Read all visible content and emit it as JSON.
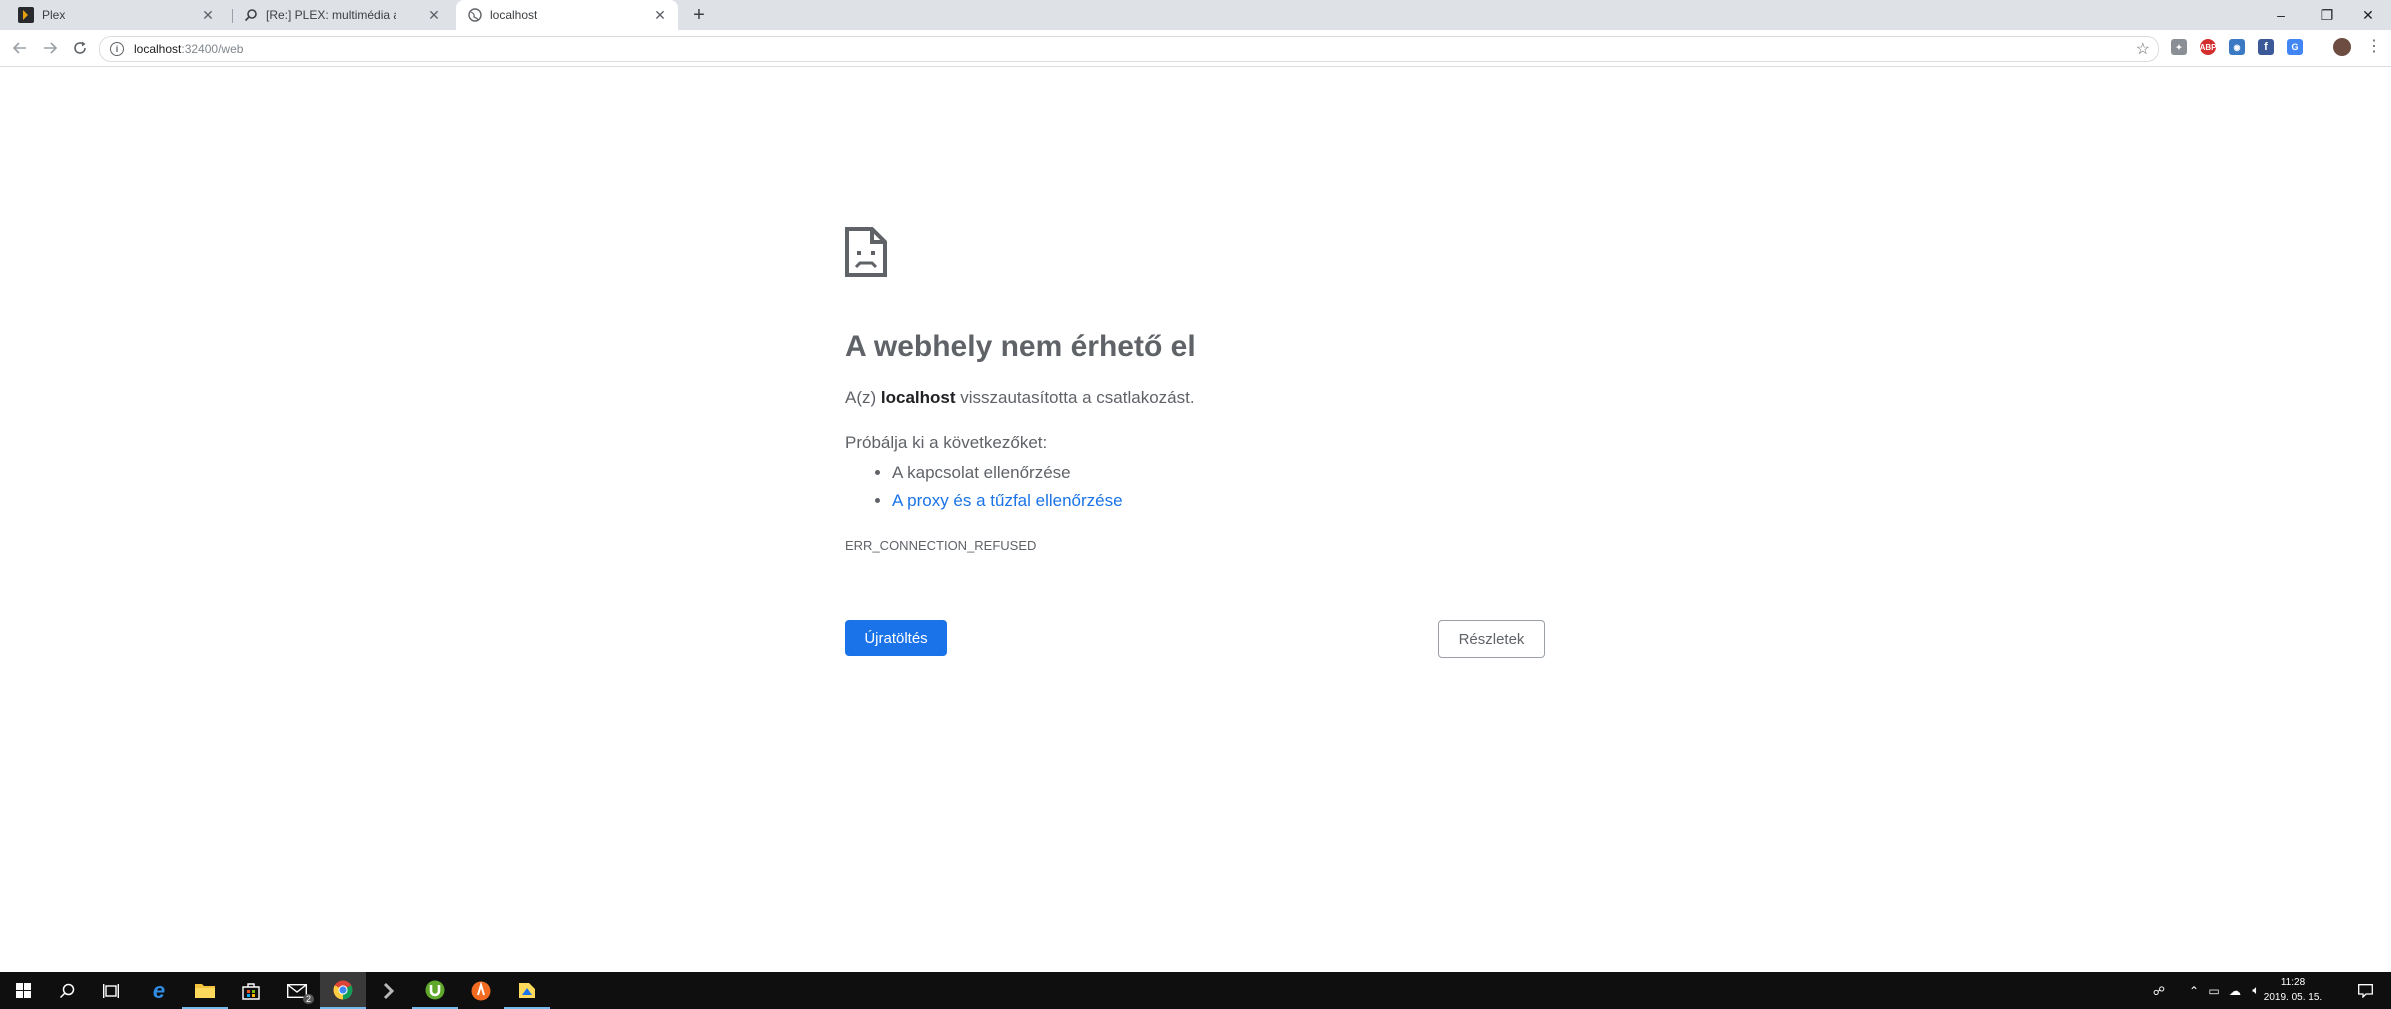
{
  "tabs": [
    {
      "title": "Plex",
      "favicon": "plex-icon",
      "active": false
    },
    {
      "title": "[Re:] PLEX: multimédia az egész h",
      "favicon": "search-icon",
      "active": false
    },
    {
      "title": "localhost",
      "favicon": "globe-icon",
      "active": true
    }
  ],
  "new_tab": "+",
  "window": {
    "minimize": "–",
    "restore": "❐",
    "close": "✕"
  },
  "address": {
    "host": "localhost",
    "path": ":32400/web"
  },
  "extensions": [
    "puzzle-extension-icon",
    "adblock-icon",
    "extension-icon",
    "facebook-icon",
    "translate-icon"
  ],
  "error": {
    "title": "A webhely nem érhető el",
    "msg_pre": "A(z) ",
    "msg_host": "localhost",
    "msg_post": " visszautasította a csatlakozást.",
    "try_label": "Próbálja ki a következőket:",
    "suggestions": [
      "A kapcsolat ellenőrzése",
      "A proxy és a tűzfal ellenőrzése"
    ],
    "code": "ERR_CONNECTION_REFUSED",
    "reload_button": "Újratöltés",
    "details_button": "Részletek"
  },
  "taskbar": {
    "clock_time": "11:28",
    "clock_date": "2019. 05. 15.",
    "mail_badge": "2"
  },
  "colors": {
    "accent": "#1a73e8",
    "link": "#1a73e8",
    "taskbar": "#0f0f0f"
  }
}
